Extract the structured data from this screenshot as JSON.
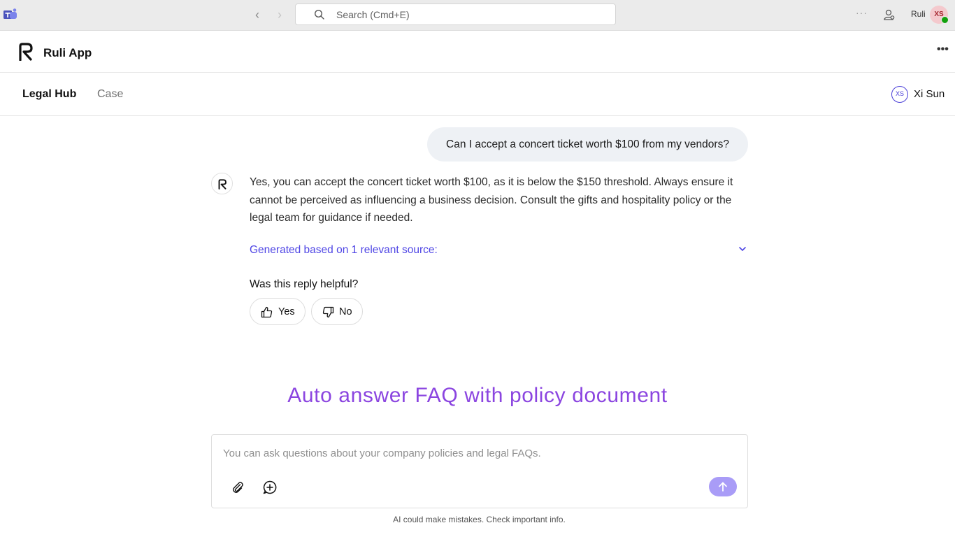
{
  "titlebar": {
    "search_placeholder": "Search (Cmd+E)",
    "user_name": "Ruli",
    "avatar_initials": "XS",
    "more": "···"
  },
  "app": {
    "name": "Ruli App",
    "more": "•••"
  },
  "tabs": [
    {
      "label": "Legal Hub",
      "active": true
    },
    {
      "label": "Case",
      "active": false
    }
  ],
  "user": {
    "initials": "XS",
    "name": "Xi Sun"
  },
  "chat": {
    "user_message": "Can I accept a concert ticket worth $100 from my vendors?",
    "bot_reply": "Yes, you can accept the concert ticket worth $100, as it is below the $150 threshold. Always ensure it cannot be perceived as influencing a business decision. Consult the gifts and hospitality policy or the legal team for guidance if needed.",
    "sources_label": "Generated based on 1 relevant source:",
    "helpful_question": "Was this reply helpful?",
    "yes_label": "Yes",
    "no_label": "No"
  },
  "caption": "Auto answer FAQ with policy document",
  "composer": {
    "placeholder": "You can ask questions about your company policies and legal FAQs.",
    "value": ""
  },
  "disclaimer": "AI could make mistakes. Check important info.",
  "colors": {
    "accent": "#4f46e5",
    "send_button": "#a99cf7",
    "caption": "#8b45e0",
    "user_bubble": "#eef1f5"
  }
}
